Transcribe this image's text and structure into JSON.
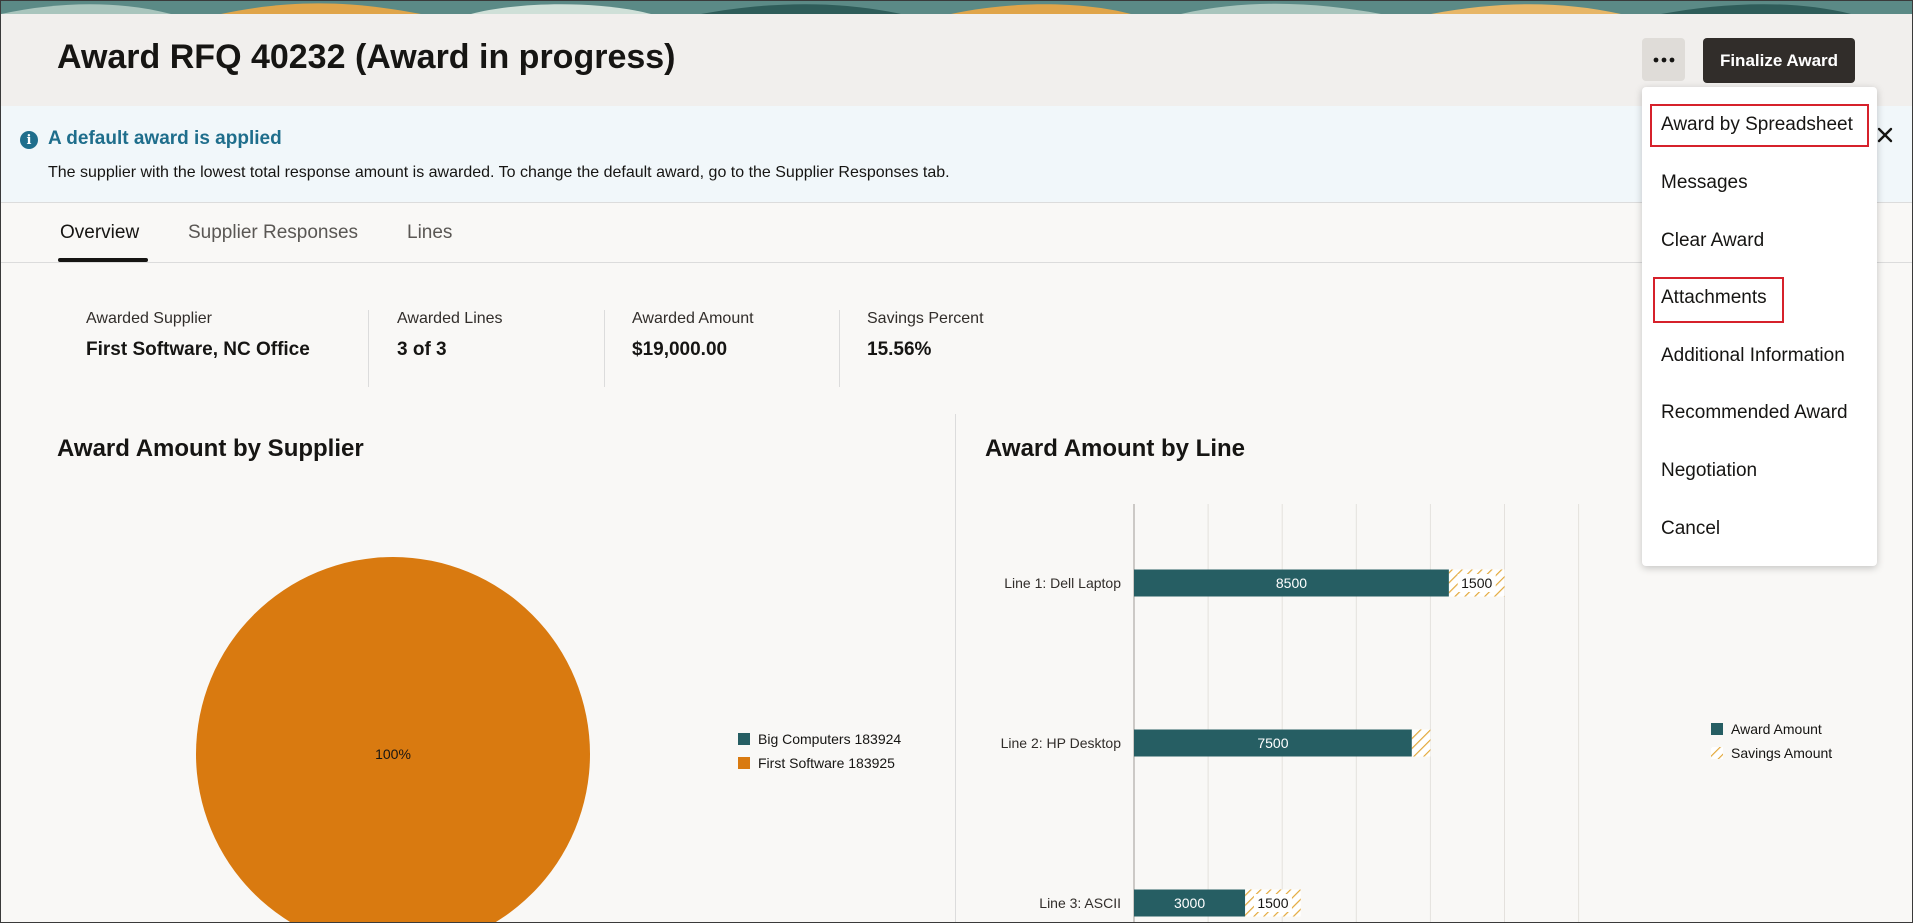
{
  "header": {
    "title": "Award RFQ 40232 (Award in progress)",
    "more_icon": "ellipsis-icon",
    "finalize_label": "Finalize Award"
  },
  "info": {
    "icon": "info-icon",
    "title": "A default award is applied",
    "text": "The supplier with the lowest total response amount is awarded. To change the default award, go to the Supplier Responses tab.",
    "close_icon": "close-icon"
  },
  "tabs": [
    {
      "label": "Overview",
      "active": true
    },
    {
      "label": "Supplier Responses",
      "active": false
    },
    {
      "label": "Lines",
      "active": false
    }
  ],
  "summary": [
    {
      "label": "Awarded Supplier",
      "value": "First Software, NC Office"
    },
    {
      "label": "Awarded Lines",
      "value": "3 of 3"
    },
    {
      "label": "Awarded Amount",
      "value": "$19,000.00"
    },
    {
      "label": "Savings Percent",
      "value": "15.56%"
    }
  ],
  "charts": {
    "supplier_title": "Award Amount by Supplier",
    "line_title": "Award Amount by Line"
  },
  "menu": {
    "items": [
      {
        "label": "Award by Spreadsheet",
        "highlighted": true
      },
      {
        "label": "Messages",
        "highlighted": false
      },
      {
        "label": "Clear Award",
        "highlighted": false
      },
      {
        "label": "Attachments",
        "highlighted": true
      },
      {
        "label": "Additional Information",
        "highlighted": false
      },
      {
        "label": "Recommended Award",
        "highlighted": false
      },
      {
        "label": "Negotiation",
        "highlighted": false
      },
      {
        "label": "Cancel",
        "highlighted": false
      }
    ]
  },
  "colors": {
    "award": "#265e63",
    "savings": "#e3a93c",
    "pie_first_software": "#d97a10",
    "pie_big_computers": "#265e63",
    "highlight": "#d6212b",
    "info_accent": "#1f6e8c"
  },
  "chart_data": [
    {
      "type": "pie",
      "title": "Award Amount by Supplier",
      "slices": [
        {
          "name": "Big Computers 183924",
          "value": 0,
          "label": ""
        },
        {
          "name": "First Software 183925",
          "value": 100,
          "label": "100%"
        }
      ],
      "legend_position": "right"
    },
    {
      "type": "bar",
      "orientation": "horizontal",
      "stacked": true,
      "title": "Award Amount by Line",
      "categories": [
        "Line 1: Dell Laptop",
        "Line 2: HP Desktop",
        "Line 3: ASCII"
      ],
      "series": [
        {
          "name": "Award Amount",
          "values": [
            8500,
            7500,
            3000
          ],
          "labels": [
            "8500",
            "7500",
            "3000"
          ]
        },
        {
          "name": "Savings Amount",
          "values": [
            1500,
            500,
            1500
          ],
          "labels": [
            "1500",
            "",
            "1500"
          ]
        }
      ],
      "xlim": [
        0,
        12000
      ],
      "grid": true,
      "legend_position": "right"
    }
  ]
}
